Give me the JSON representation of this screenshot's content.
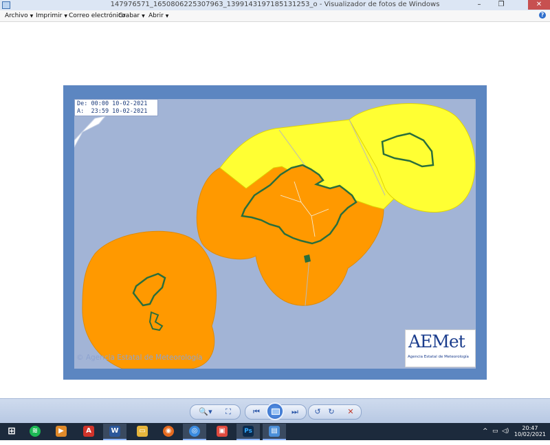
{
  "window": {
    "title": "147976571_1650806225307963_1399143197185131253_o - Visualizador de fotos de Windows",
    "minimize_glyph": "–",
    "maximize_glyph": "❐",
    "close_glyph": "✕"
  },
  "menu": {
    "items": [
      {
        "label": "Archivo"
      },
      {
        "label": "Imprimir"
      },
      {
        "label": "Correo electrónico"
      },
      {
        "label": "Grabar"
      },
      {
        "label": "Abrir"
      }
    ],
    "help_glyph": "?"
  },
  "map": {
    "date_from": "De: 00:00 10-02-2021",
    "date_to": "A:  23:59 10-02-2021",
    "copyright": "© Agencia Estatal de Meteorología",
    "logo_word": "AEMet",
    "logo_sub": "Agencia Estatal de Meteorología",
    "colors": {
      "sea": "#a2b4d6",
      "orange_warning": "#ff9900",
      "yellow_warning": "#ffff33",
      "coast": "#2a6e3c"
    }
  },
  "controls": {
    "zoom": "🔍▾",
    "fit": "⛶",
    "prev": "⏮",
    "next": "⏭",
    "rotate_left": "↺",
    "rotate_right": "↻",
    "delete": "✕"
  },
  "taskbar": {
    "apps": [
      {
        "name": "start-icon",
        "glyph": "⊞",
        "color": "#1c2a3c"
      },
      {
        "name": "spotify-icon",
        "glyph": "≋",
        "color": "#1db954"
      },
      {
        "name": "media-player-icon",
        "glyph": "▶",
        "color": "#e08a2a"
      },
      {
        "name": "acrobat-icon",
        "glyph": "A",
        "color": "#d0332a"
      },
      {
        "name": "word-icon",
        "glyph": "W",
        "color": "#2b579a"
      },
      {
        "name": "file-explorer-icon",
        "glyph": "▭",
        "color": "#e6b53c"
      },
      {
        "name": "firefox-icon",
        "glyph": "◉",
        "color": "#e66a1f"
      },
      {
        "name": "chrome-icon",
        "glyph": "◎",
        "color": "#3b8be0"
      },
      {
        "name": "app-red-icon",
        "glyph": "▣",
        "color": "#e04a3f"
      },
      {
        "name": "photoshop-icon",
        "glyph": "Ps",
        "color": "#0b2a4c"
      },
      {
        "name": "photo-viewer-icon",
        "glyph": "▤",
        "color": "#4a8ed8"
      }
    ],
    "time": "20:47",
    "date": "10/02/2021"
  }
}
